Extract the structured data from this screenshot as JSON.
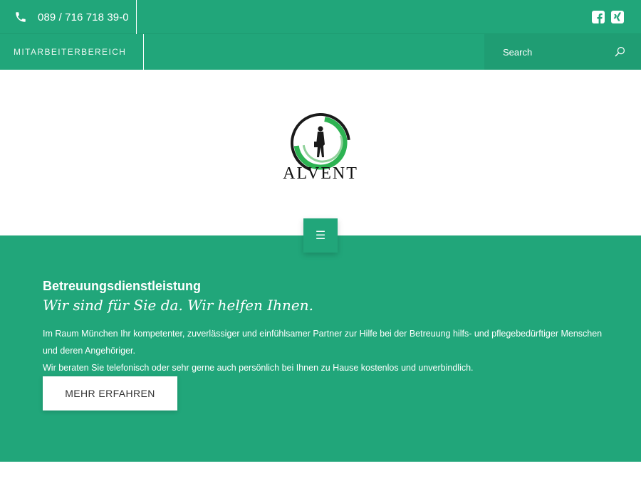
{
  "topbar": {
    "phone": "089 / 716 718 39-0",
    "socials": [
      {
        "icon": "facebook-icon"
      },
      {
        "icon": "xing-icon"
      }
    ]
  },
  "secondary_bar": {
    "staff_link": "MITARBEITERBEREICH",
    "search": {
      "placeholder": "Search",
      "icon": "search-icon"
    }
  },
  "logo": {
    "text": "ALVENT"
  },
  "nav": {
    "menu_icon": "☰"
  },
  "hero": {
    "title": "Betreuungsdienstleistung",
    "subtitle": "Wir sind für Sie da. Wir helfen Ihnen.",
    "paragraph_1": "Im Raum München Ihr kompetenter, zuverlässiger und einfühlsamer Partner zur Hilfe bei der Betreuung hilfs- und pflegebedürftiger Menschen und deren Angehöriger.",
    "paragraph_2": "Wir beraten Sie telefonisch oder sehr gerne auch persönlich bei Ihnen zu Hause kostenlos und unverbindlich.",
    "button": "MEHR ERFAHREN"
  },
  "colors": {
    "brand": "#21a67a",
    "white": "#ffffff"
  }
}
